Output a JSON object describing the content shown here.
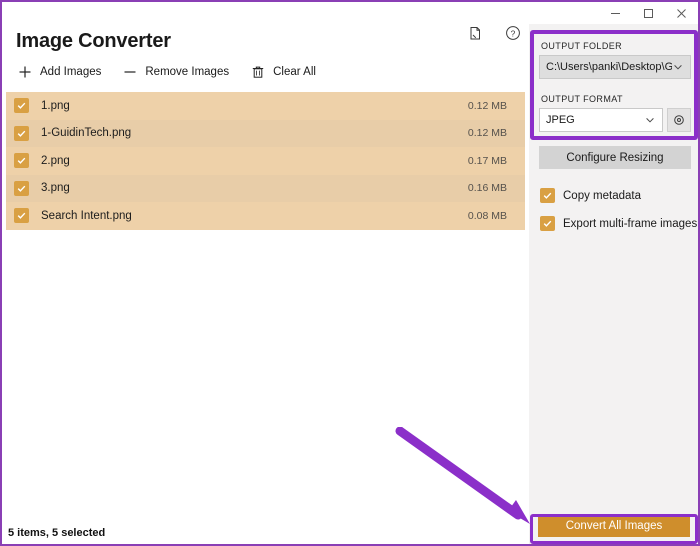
{
  "window": {
    "title_bar_buttons": [
      {
        "name": "minimize",
        "glyph": "minimize-icon"
      },
      {
        "name": "maximize",
        "glyph": "maximize-icon"
      },
      {
        "name": "close",
        "glyph": "close-icon"
      }
    ]
  },
  "header": {
    "title": "Image Converter",
    "icons": [
      {
        "name": "feedback-icon",
        "label": "Feedback"
      },
      {
        "name": "help-icon",
        "label": "Help"
      }
    ]
  },
  "command_bar": {
    "items": [
      {
        "icon": "plus-icon",
        "label": "Add Images"
      },
      {
        "icon": "minus-icon",
        "label": "Remove Images"
      },
      {
        "icon": "trash-icon",
        "label": "Clear All"
      }
    ]
  },
  "file_list": {
    "rows": [
      {
        "name": "1.png",
        "size": "0.12 MB",
        "checked": true
      },
      {
        "name": "1-GuidinTech.png",
        "size": "0.12 MB",
        "checked": true
      },
      {
        "name": "2.png",
        "size": "0.17 MB",
        "checked": true
      },
      {
        "name": "3.png",
        "size": "0.16 MB",
        "checked": true
      },
      {
        "name": "Search Intent.png",
        "size": "0.08 MB",
        "checked": true
      }
    ]
  },
  "status_bar": {
    "text": "5 items, 5 selected"
  },
  "sidebar": {
    "output_folder": {
      "label": "OUTPUT FOLDER",
      "value": "C:\\Users\\panki\\Desktop\\Guidi",
      "chevron": "chevron-down-icon"
    },
    "output_format": {
      "label": "OUTPUT FORMAT",
      "value": "JPEG",
      "chevron": "chevron-down-icon",
      "settings_icon": "gear-icon"
    },
    "configure_resizing_label": "Configure Resizing",
    "checkboxes": [
      {
        "label": "Copy metadata",
        "checked": true
      },
      {
        "label": "Export multi-frame images",
        "checked": true
      }
    ],
    "convert_button_label": "Convert All Images"
  },
  "colors": {
    "accent_amber": "#cf8e2c",
    "row_odd": "#eed1a9",
    "row_even": "#e8cda8",
    "annotation_purple": "#8b2fc9",
    "window_border": "#8a3fb5",
    "sidebar_bg": "#f3f2f2"
  }
}
